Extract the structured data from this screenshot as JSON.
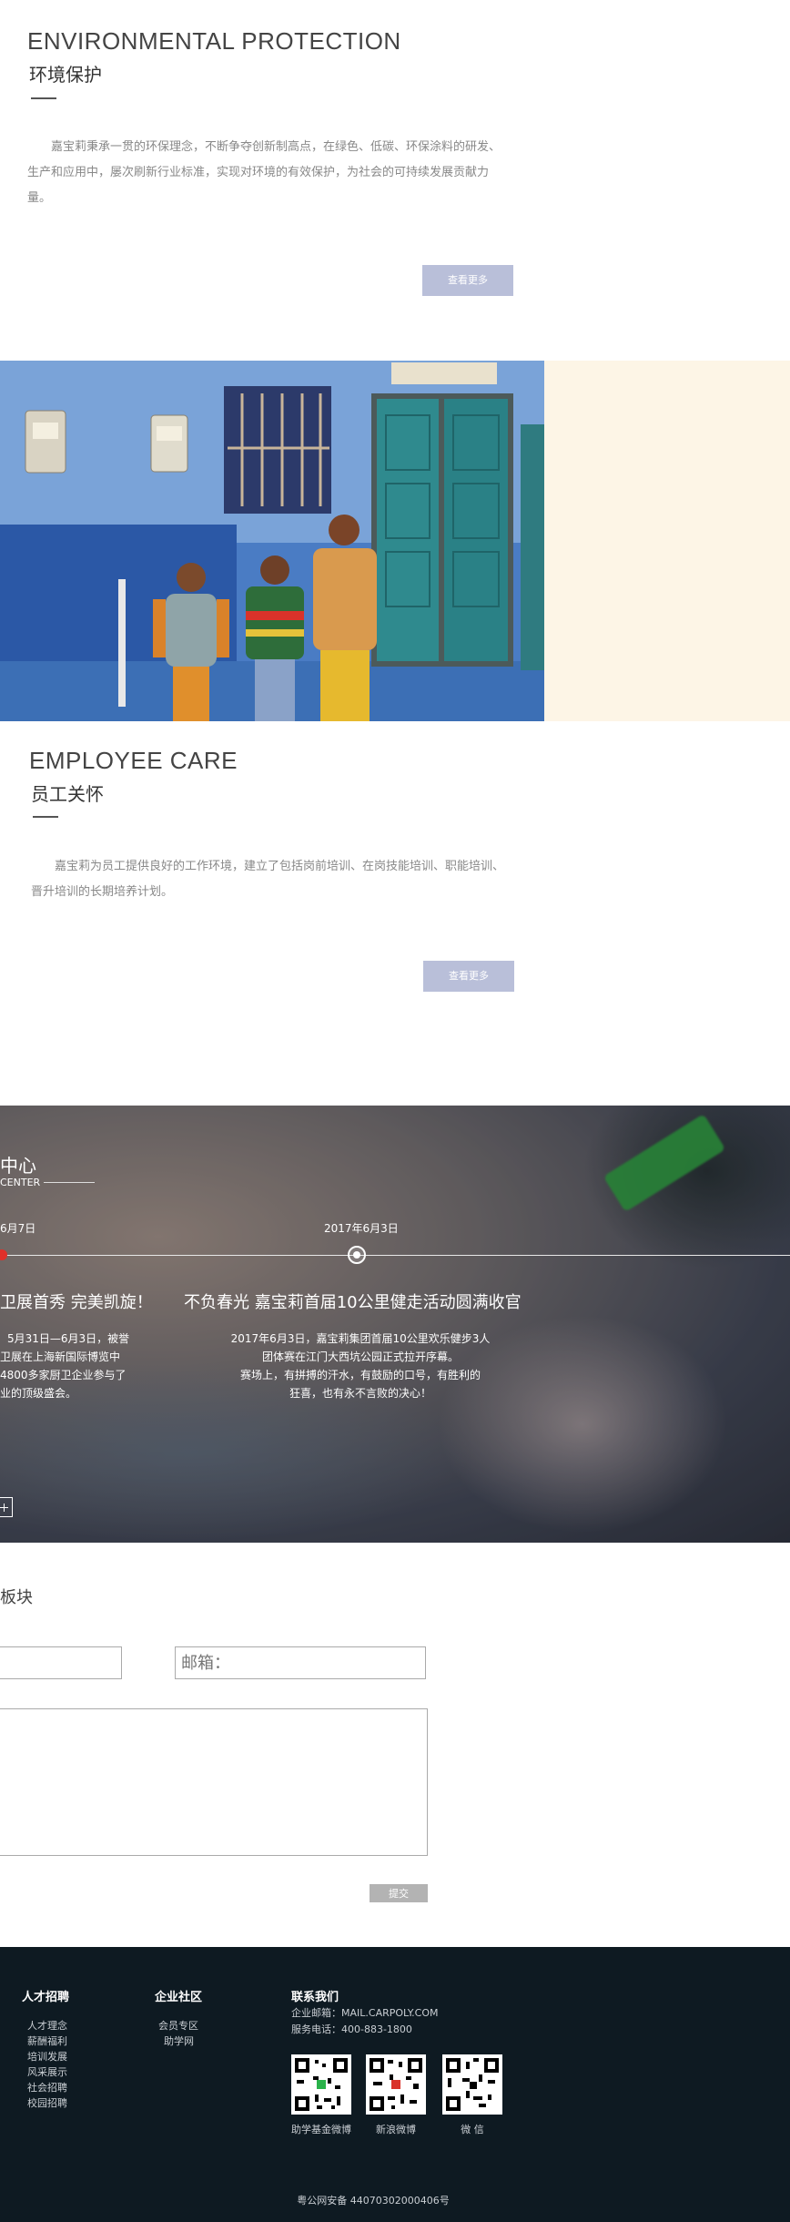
{
  "env": {
    "en_title": "ENVIRONMENTAL PROTECTION",
    "cn_title": "环境保护",
    "body": "嘉宝莉秉承一贯的环保理念，不断争夺创新制高点，在绿色、低碳、环保涂料的研发、生产和应用中，屡次刷新行业标准，实现对环境的有效保护，为社会的可持续发展贡献力量。",
    "more": "查看更多"
  },
  "employee": {
    "en_title": "EMPLOYEE CARE",
    "cn_title": "员工关怀",
    "body": "嘉宝莉为员工提供良好的工作环境，建立了包括岗前培训、在岗技能培训、职能培训、晋升培训的长期培养计划。",
    "more": "查看更多"
  },
  "news": {
    "section_title": "中心",
    "section_sub": "CENTER",
    "date_left": "6月7日",
    "date_mid": "2017年6月3日",
    "left_title": "卫展首秀 完美凯旋！",
    "left_lines": [
      "5月31日—6月3日，被誉",
      "卫展在上海新国际博览中",
      "4800多家厨卫企业参与了",
      "业的顶级盛会。"
    ],
    "mid_title": "不负春光 嘉宝莉首届10公里健走活动圆满收官",
    "mid_lines": [
      "2017年6月3日，嘉宝莉集团首届10公里欢乐健步3人",
      "团体赛在江门大西坑公园正式拉开序幕。",
      "赛场上，有拼搏的汗水，有鼓励的口号，有胜利的",
      "狂喜，也有永不言败的决心！"
    ]
  },
  "form": {
    "section_title": "板块",
    "email_placeholder": "邮箱：",
    "submit": "提交"
  },
  "footer": {
    "col1": {
      "title": "人才招聘",
      "links": [
        "人才理念",
        "薪酬福利",
        "培训发展",
        "风采展示",
        "社会招聘",
        "校园招聘"
      ]
    },
    "col2": {
      "title": "企业社区",
      "links": [
        "会员专区",
        "助学网"
      ]
    },
    "col3": {
      "title": "联系我们",
      "email": "企业邮箱：MAIL.CARPOLY.COM",
      "phone": "服务电话：400-883-1800"
    },
    "qr_labels": [
      "助学基金微博",
      "新浪微博",
      "微 信"
    ],
    "icp": "粤公网安备 44070302000406号"
  },
  "colors": {
    "button": "#b9bfd9",
    "footer_bg": "#0e1a22",
    "cream": "#fdf5e6",
    "timeline_active": "#e0302a"
  }
}
